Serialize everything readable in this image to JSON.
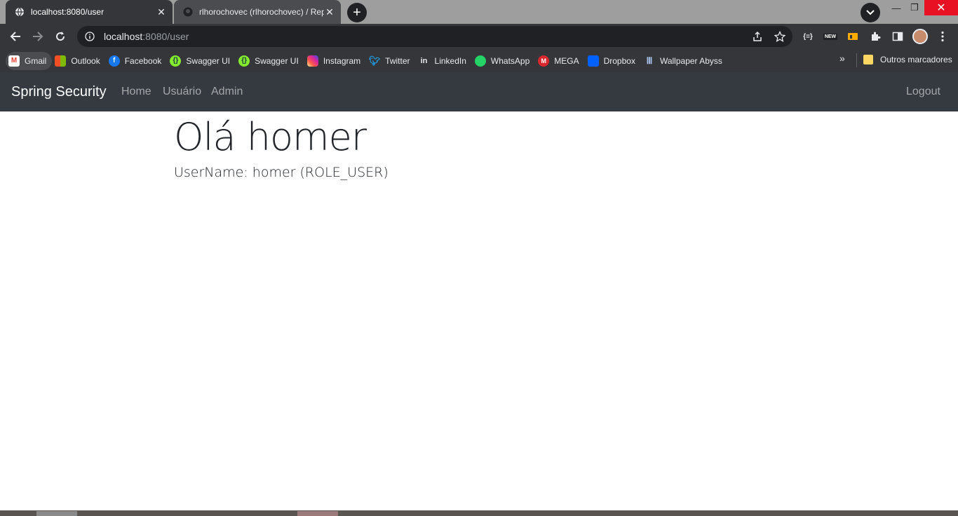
{
  "tabs": [
    {
      "title": "localhost:8080/user",
      "favicon": "globe-icon",
      "active": true
    },
    {
      "title": "rlhorochovec (rlhorochovec) / Rep",
      "favicon": "github-icon",
      "active": false
    }
  ],
  "address_bar": {
    "host": "localhost",
    "path": ":8080/user"
  },
  "bookmarks": [
    {
      "label": "Gmail",
      "icon": "gmail-icon",
      "color": "#ea4335"
    },
    {
      "label": "Outlook",
      "icon": "outlook-icon",
      "color": "#0078d4"
    },
    {
      "label": "Facebook",
      "icon": "facebook-icon",
      "color": "#1877f2"
    },
    {
      "label": "Swagger UI",
      "icon": "swagger-icon",
      "color": "#85ea2d"
    },
    {
      "label": "Swagger UI",
      "icon": "swagger-icon",
      "color": "#85ea2d"
    },
    {
      "label": "Instagram",
      "icon": "instagram-icon",
      "color": "#d6249f"
    },
    {
      "label": "Twitter",
      "icon": "twitter-icon",
      "color": "#1da1f2"
    },
    {
      "label": "LinkedIn",
      "icon": "linkedin-icon",
      "color": "#0a66c2"
    },
    {
      "label": "WhatsApp",
      "icon": "whatsapp-icon",
      "color": "#25d366"
    },
    {
      "label": "MEGA",
      "icon": "mega-icon",
      "color": "#d9272e"
    },
    {
      "label": "Dropbox",
      "icon": "dropbox-icon",
      "color": "#0061ff"
    },
    {
      "label": "Wallpaper Abyss",
      "icon": "wallpaper-abyss-icon",
      "color": "#6c8ebf"
    }
  ],
  "other_bookmarks": "Outros marcadores",
  "app": {
    "brand": "Spring Security",
    "nav": {
      "home": "Home",
      "user": "Usuário",
      "admin": "Admin",
      "logout": "Logout"
    }
  },
  "page": {
    "greeting": "Olá homer",
    "username_line": "UserName: homer (ROLE_USER)"
  },
  "colors": {
    "navbar_bg": "#343a40",
    "chrome_dark": "#35363a",
    "close_red": "#e81123"
  }
}
